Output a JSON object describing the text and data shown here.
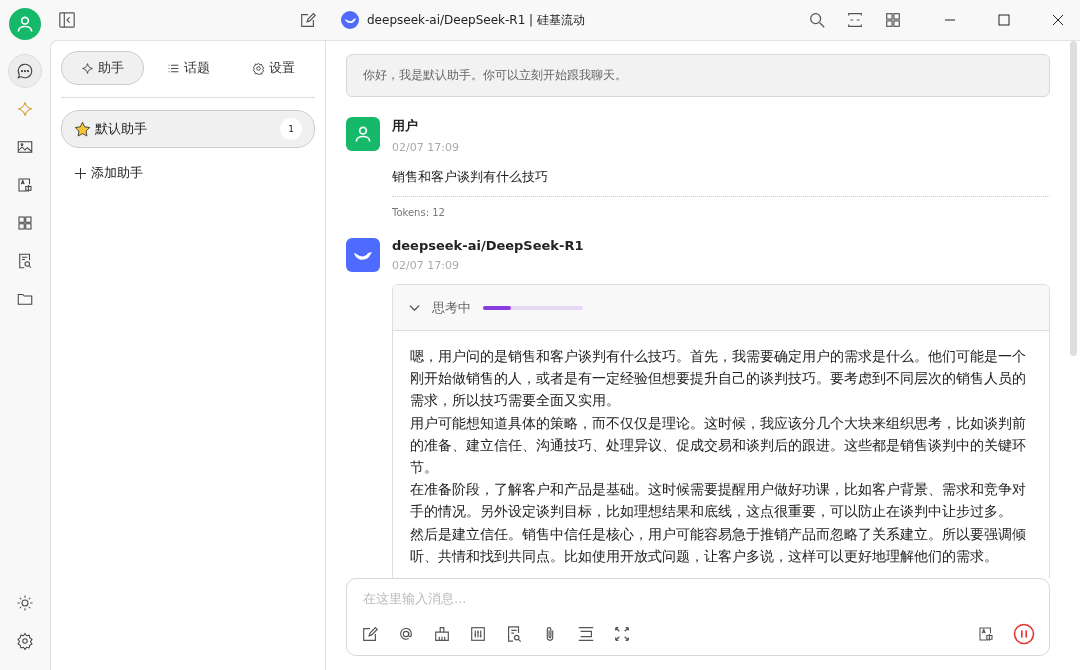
{
  "window": {
    "title": "deepseek-ai/DeepSeek-R1 | 硅基流动"
  },
  "nav": [
    {
      "kind": "chat",
      "selected": true
    },
    {
      "kind": "sparkle",
      "selected": false
    },
    {
      "kind": "image",
      "selected": false
    },
    {
      "kind": "translate",
      "selected": false
    },
    {
      "kind": "apps",
      "selected": false
    },
    {
      "kind": "docsearch",
      "selected": false
    },
    {
      "kind": "folder",
      "selected": false
    }
  ],
  "tabs": [
    {
      "kind": "assistant",
      "label": "助手",
      "selected": true
    },
    {
      "kind": "topics",
      "label": "话题",
      "selected": false
    },
    {
      "kind": "settings",
      "label": "设置",
      "selected": false
    }
  ],
  "assistants": [
    {
      "name": "默认助手",
      "count": "1",
      "selected": true
    }
  ],
  "add_assistant": "添加助手",
  "greeting": "你好，我是默认助手。你可以立刻开始跟我聊天。",
  "messages": [
    {
      "kind": "user",
      "author": "用户",
      "time": "02/07 17:09",
      "text": "销售和客户谈判有什么技巧",
      "tokens": "Tokens: 12"
    },
    {
      "kind": "model",
      "author": "deepseek-ai/DeepSeek-R1",
      "time": "02/07 17:09",
      "thinking": {
        "label": "思考中",
        "level": 0.28,
        "expanded": true,
        "paragraphs": [
          "嗯，用户问的是销售和客户谈判有什么技巧。首先，我需要确定用户的需求是什么。他们可能是一个刚开始做销售的人，或者是有一定经验但想要提升自己的谈判技巧。要考虑到不同层次的销售人员的需求，所以技巧需要全面又实用。",
          "用户可能想知道具体的策略，而不仅仅是理论。这时候，我应该分几个大块来组织思考，比如谈判前的准备、建立信任、沟通技巧、处理异议、促成交易和谈判后的跟进。这些都是销售谈判中的关键环节。",
          "在准备阶段，了解客户和产品是基础。这时候需要提醒用户做好功课，比如客户背景、需求和竞争对手的情况。另外设定谈判目标，比如理想结果和底线，这点很重要，可以防止在谈判中让步过多。",
          "然后是建立信任。销售中信任是核心，用户可能容易急于推销产品而忽略了关系建立。所以要强调倾听、共情和找到共同点。比如使用开放式问题，让客户多说，这样可以更好地理解他们的需求。"
        ]
      }
    }
  ],
  "input": {
    "placeholder": "在这里输入消息...",
    "generating": true
  }
}
